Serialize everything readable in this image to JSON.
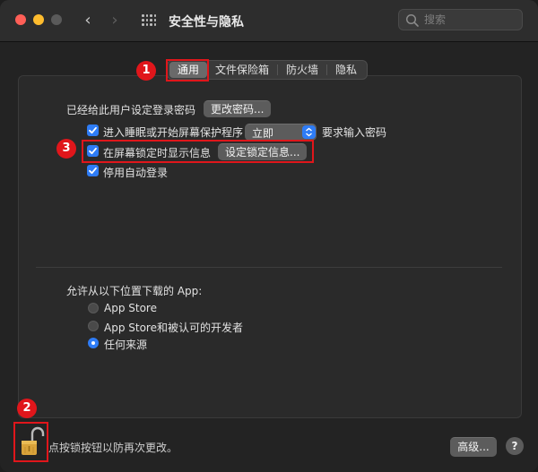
{
  "window": {
    "title": "安全性与隐私",
    "nav_back": "‹",
    "nav_forward": "›"
  },
  "search": {
    "placeholder": "搜索"
  },
  "tabs": [
    {
      "label": "通用",
      "active": true
    },
    {
      "label": "文件保险箱",
      "active": false
    },
    {
      "label": "防火墙",
      "active": false
    },
    {
      "label": "隐私",
      "active": false
    }
  ],
  "general": {
    "password_label": "已经给此用户设定登录密码",
    "change_password_button": "更改密码...",
    "require_password_prefix": "进入睡眠或开始屏幕保护程序",
    "require_password_select": "立即",
    "require_password_suffix": "要求输入密码",
    "show_message_label": "在屏幕锁定时显示信息",
    "set_lock_message_button": "设定锁定信息...",
    "disable_autologin_label": "停用自动登录"
  },
  "downloads": {
    "heading": "允许从以下位置下载的 App:",
    "options": [
      {
        "label": "App Store",
        "selected": false
      },
      {
        "label": "App Store和被认可的开发者",
        "selected": false
      },
      {
        "label": "任何来源",
        "selected": true
      }
    ]
  },
  "footer": {
    "lock_text": "点按锁按钮以防再次更改。",
    "advanced_button": "高级...",
    "help_button": "?"
  },
  "annotations": [
    "1",
    "2",
    "3"
  ],
  "colors": {
    "accent": "#2e7cf6",
    "highlight": "#e0161b"
  }
}
